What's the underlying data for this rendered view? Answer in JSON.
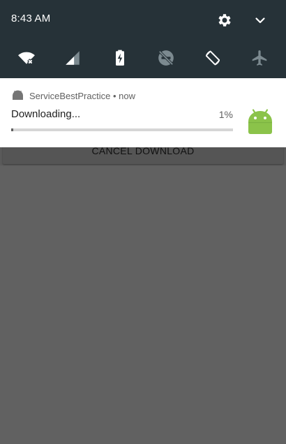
{
  "status_bar": {
    "time": "8:43 AM",
    "settings_icon": "gear-icon",
    "expand_icon": "chevron-down-icon"
  },
  "quick_settings": {
    "tiles": [
      {
        "icon": "wifi-off-icon",
        "active": true
      },
      {
        "icon": "cellular-signal-icon",
        "active": true
      },
      {
        "icon": "battery-charging-icon",
        "active": true
      },
      {
        "icon": "do-not-disturb-off-icon",
        "active": false
      },
      {
        "icon": "auto-rotate-icon",
        "active": true
      },
      {
        "icon": "airplane-mode-icon",
        "active": false
      }
    ]
  },
  "notification": {
    "app_name": "ServiceBestPractice",
    "time": "now",
    "title": "Downloading...",
    "percent_text": "1%",
    "progress": 0.01,
    "large_icon": "android-icon",
    "small_icon": "android-icon"
  },
  "app": {
    "cancel_button_label": "CANCEL DOWNLOAD"
  },
  "colors": {
    "shade_background": "#263238",
    "android_green": "#8BC34A",
    "dimmed_app": "#616161"
  }
}
